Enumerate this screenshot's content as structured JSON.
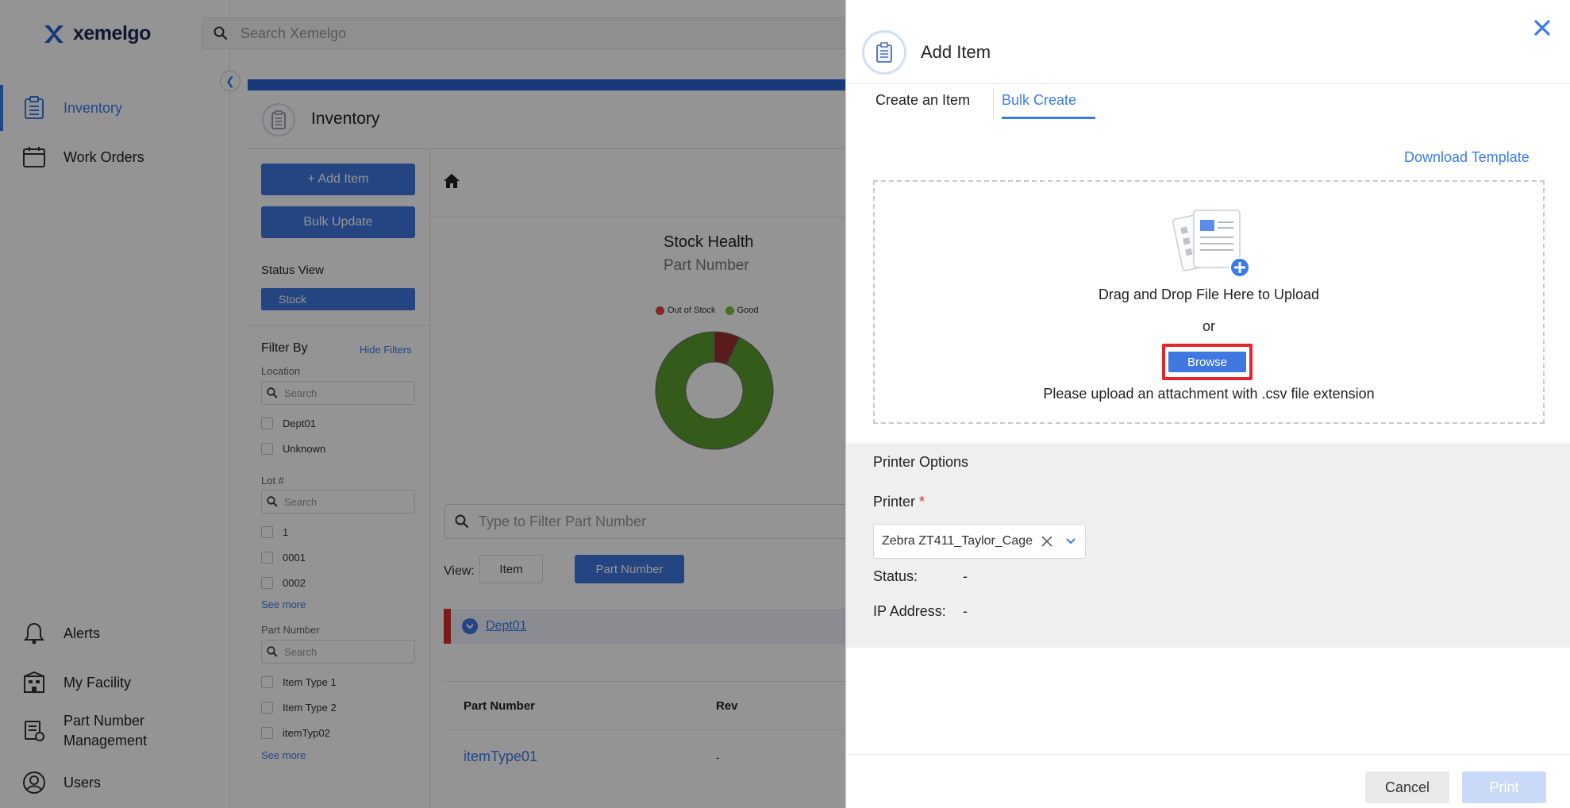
{
  "brand": {
    "name": "xemelgo"
  },
  "search": {
    "placeholder": "Search Xemelgo"
  },
  "sidebar": {
    "top_items": [
      {
        "label": "Inventory",
        "icon": "clipboard-icon",
        "active": true
      },
      {
        "label": "Work Orders",
        "icon": "calendar-icon",
        "active": false
      }
    ],
    "bottom_items": [
      {
        "label": "Alerts",
        "icon": "bell-icon"
      },
      {
        "label": "My Facility",
        "icon": "building-icon"
      },
      {
        "label_line1": "Part Number",
        "label_line2": "Management",
        "icon": "part-management-icon"
      },
      {
        "label": "Users",
        "icon": "user-icon"
      }
    ]
  },
  "page": {
    "title": "Inventory"
  },
  "actions": {
    "add_item": "+ Add Item",
    "bulk_update": "Bulk Update"
  },
  "status_view": {
    "label": "Status View",
    "selected": "Stock"
  },
  "filters": {
    "title": "Filter By",
    "hide": "Hide Filters",
    "see_more": "See more",
    "search_placeholder": "Search",
    "groups": [
      {
        "label": "Location",
        "options": [
          "Dept01",
          "Unknown"
        ]
      },
      {
        "label": "Lot #",
        "options": [
          "1",
          "0001",
          "0002"
        ]
      },
      {
        "label": "Part Number",
        "options": [
          "Item Type 1",
          "Item Type 2",
          "itemTyp02"
        ]
      }
    ]
  },
  "chart": {
    "title": "Stock Health",
    "subtitle": "Part Number"
  },
  "chart_data": {
    "type": "pie",
    "title": "Stock Health",
    "categories": [
      "Out of Stock",
      "Good"
    ],
    "values": [
      7,
      93
    ],
    "colors": [
      "#9b2f2f",
      "#5a9e2c"
    ],
    "legend": "top"
  },
  "list": {
    "filter_placeholder": "Type to Filter Part Number",
    "view_label": "View:",
    "view_options": [
      "Item",
      "Part Number"
    ],
    "view_selected": "Part Number",
    "group": "Dept01",
    "columns": [
      "Part Number",
      "Rev"
    ],
    "rows": [
      {
        "part_number": "itemType01",
        "rev": "-"
      }
    ]
  },
  "modal": {
    "title": "Add Item",
    "tabs": [
      "Create an Item",
      "Bulk Create"
    ],
    "active_tab": "Bulk Create",
    "download_template": "Download Template",
    "dropzone": {
      "drag_text": "Drag and Drop File Here to Upload",
      "or_text": "or",
      "browse": "Browse",
      "hint": "Please upload an attachment with .csv file extension"
    },
    "printer_options": {
      "title": "Printer Options",
      "printer_label": "Printer",
      "required_mark": "*",
      "printer_value": "Zebra ZT411_Taylor_Cage",
      "status_label": "Status:",
      "status_value": "-",
      "ip_label": "IP Address:",
      "ip_value": "-"
    },
    "footer": {
      "cancel": "Cancel",
      "print": "Print"
    }
  },
  "colors": {
    "accent": "#3a7bea",
    "button_blue": "#3f78e0",
    "highlight_red": "#e2262b",
    "out_of_stock": "#9b2f2f",
    "good": "#5a9e2c"
  }
}
